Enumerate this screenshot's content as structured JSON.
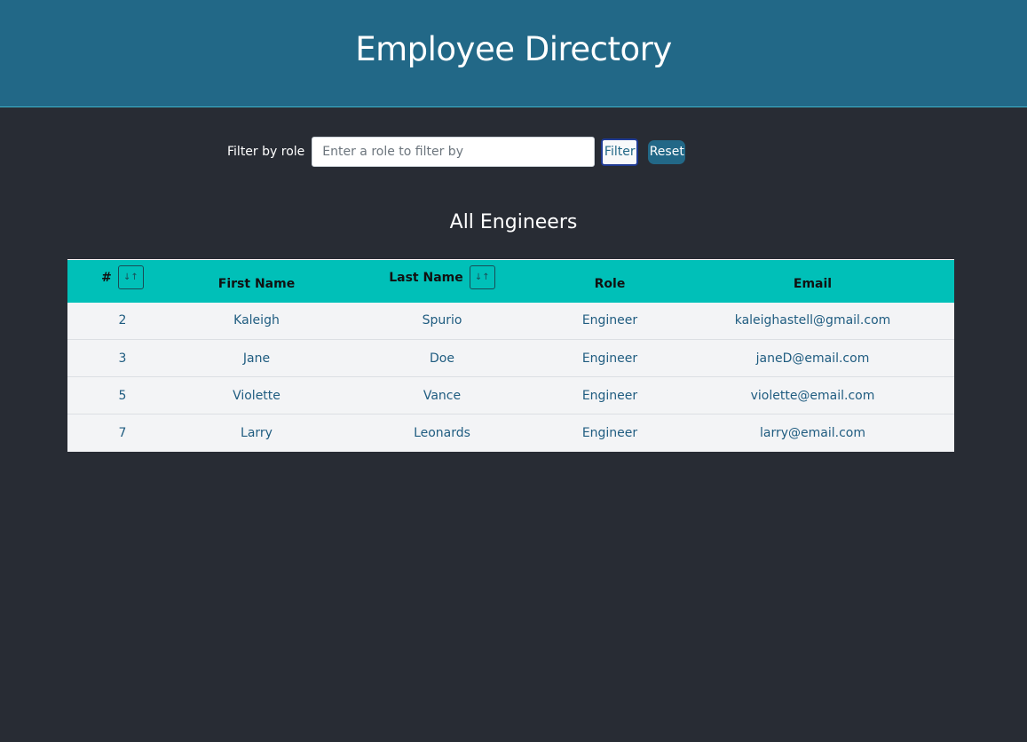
{
  "header": {
    "title": "Employee Directory"
  },
  "filter": {
    "label": "Filter by role",
    "placeholder": "Enter a role to filter by",
    "value": "",
    "filter_button": "Filter",
    "reset_button": "Reset"
  },
  "section": {
    "title": "All Engineers"
  },
  "table": {
    "columns": {
      "id": "#",
      "first_name": "First Name",
      "last_name": "Last Name",
      "role": "Role",
      "email": "Email"
    },
    "sort_glyph": "↓↑",
    "rows": [
      {
        "id": "2",
        "first_name": "Kaleigh",
        "last_name": "Spurio",
        "role": "Engineer",
        "email": "kaleighastell@gmail.com"
      },
      {
        "id": "3",
        "first_name": "Jane",
        "last_name": "Doe",
        "role": "Engineer",
        "email": "janeD@email.com"
      },
      {
        "id": "5",
        "first_name": "Violette",
        "last_name": "Vance",
        "role": "Engineer",
        "email": "violette@email.com"
      },
      {
        "id": "7",
        "first_name": "Larry",
        "last_name": "Leonards",
        "role": "Engineer",
        "email": "larry@email.com"
      }
    ]
  },
  "colors": {
    "header_bg": "#226887",
    "page_bg": "#282c34",
    "table_header_bg": "#00c0b8",
    "row_bg": "#f3f4f6",
    "row_text": "#1f5c80"
  }
}
